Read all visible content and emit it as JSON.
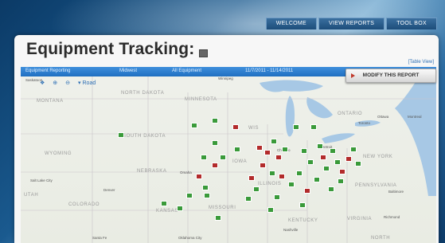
{
  "nav": {
    "tabs": [
      "WELCOME",
      "VIEW REPORTS",
      "TOOL BOX"
    ]
  },
  "page": {
    "title": "Equipment Tracking:",
    "table_view_link": "[Table View]"
  },
  "report_bar": {
    "type": "Equipment Reporting",
    "region": "Midwest",
    "equipment": "All Equipment",
    "date_range": "11/7/2011 - 11/14/2011",
    "modify_button": "MODIFY THIS REPORT"
  },
  "map": {
    "road_label": "Road",
    "labels": [
      {
        "text": "MONTANA"
      },
      {
        "text": "NORTH DAKOTA"
      },
      {
        "text": "MINNESOTA"
      },
      {
        "text": "SOUTH DAKOTA"
      },
      {
        "text": "WYOMING"
      },
      {
        "text": "NEBRASKA"
      },
      {
        "text": "IOWA"
      },
      {
        "text": "UTAH"
      },
      {
        "text": "COLORADO"
      },
      {
        "text": "KANSAS"
      },
      {
        "text": "MISSOURI"
      },
      {
        "text": "KENTUCKY"
      },
      {
        "text": "VIRGINIA"
      },
      {
        "text": "NEW YORK"
      },
      {
        "text": "PENNSYLVANIA"
      },
      {
        "text": "ILLINOIS"
      },
      {
        "text": "ONTARIO"
      },
      {
        "text": "NORTH"
      },
      {
        "text": "WIS"
      }
    ],
    "cities": [
      "Salt Lake City",
      "Denver",
      "Omaha",
      "Chicago",
      "Detroit",
      "Toronto",
      "Ottawa",
      "Montreal",
      "Baltimore",
      "Richmond",
      "Nashville",
      "Oklahoma City",
      "Santa Fe",
      "Winnipeg",
      "Saskatoon"
    ]
  },
  "colors": {
    "marker_green": "#3a9a3a",
    "marker_red": "#b22b2b",
    "bar_blue": "#2a7bcf"
  }
}
